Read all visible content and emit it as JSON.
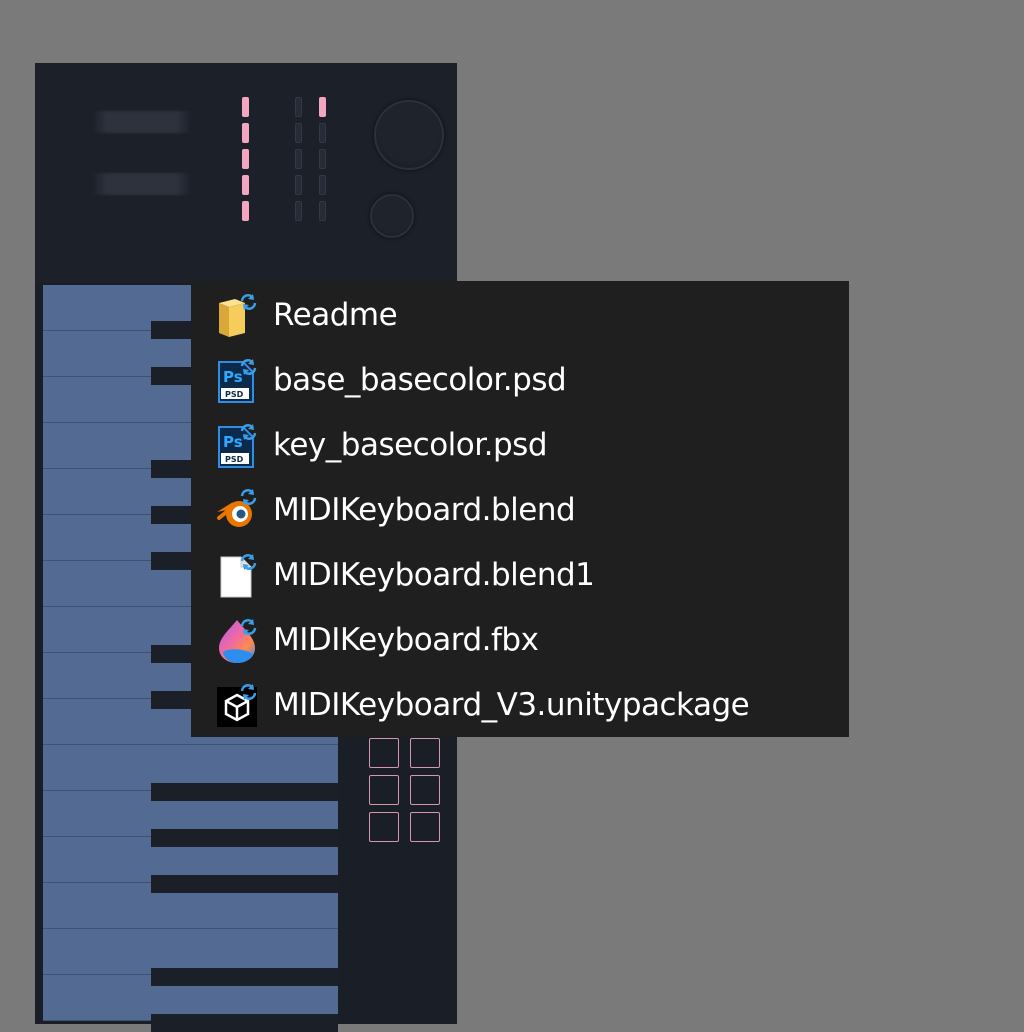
{
  "file_list": {
    "items": [
      {
        "name": "Readme",
        "icon": "folder-icon"
      },
      {
        "name": "base_basecolor.psd",
        "icon": "photoshop-psd-icon"
      },
      {
        "name": "key_basecolor.psd",
        "icon": "photoshop-psd-icon"
      },
      {
        "name": "MIDIKeyboard.blend",
        "icon": "blender-icon"
      },
      {
        "name": "MIDIKeyboard.blend1",
        "icon": "blank-file-icon"
      },
      {
        "name": "MIDIKeyboard.fbx",
        "icon": "fbx-app-icon"
      },
      {
        "name": "MIDIKeyboard_V3.unitypackage",
        "icon": "unity-package-icon"
      }
    ],
    "sync_badge_icon": "sync-arrows-icon",
    "psd_icon_label": "Ps",
    "psd_icon_sublabel": "PSD"
  },
  "colors": {
    "background": "#7a7a7a",
    "panel": "#1f1f1f",
    "device_body": "#1a1e27",
    "key_white": "#536b93",
    "accent_pink": "#f4a6c0",
    "pad_outline": "#d497ae"
  }
}
